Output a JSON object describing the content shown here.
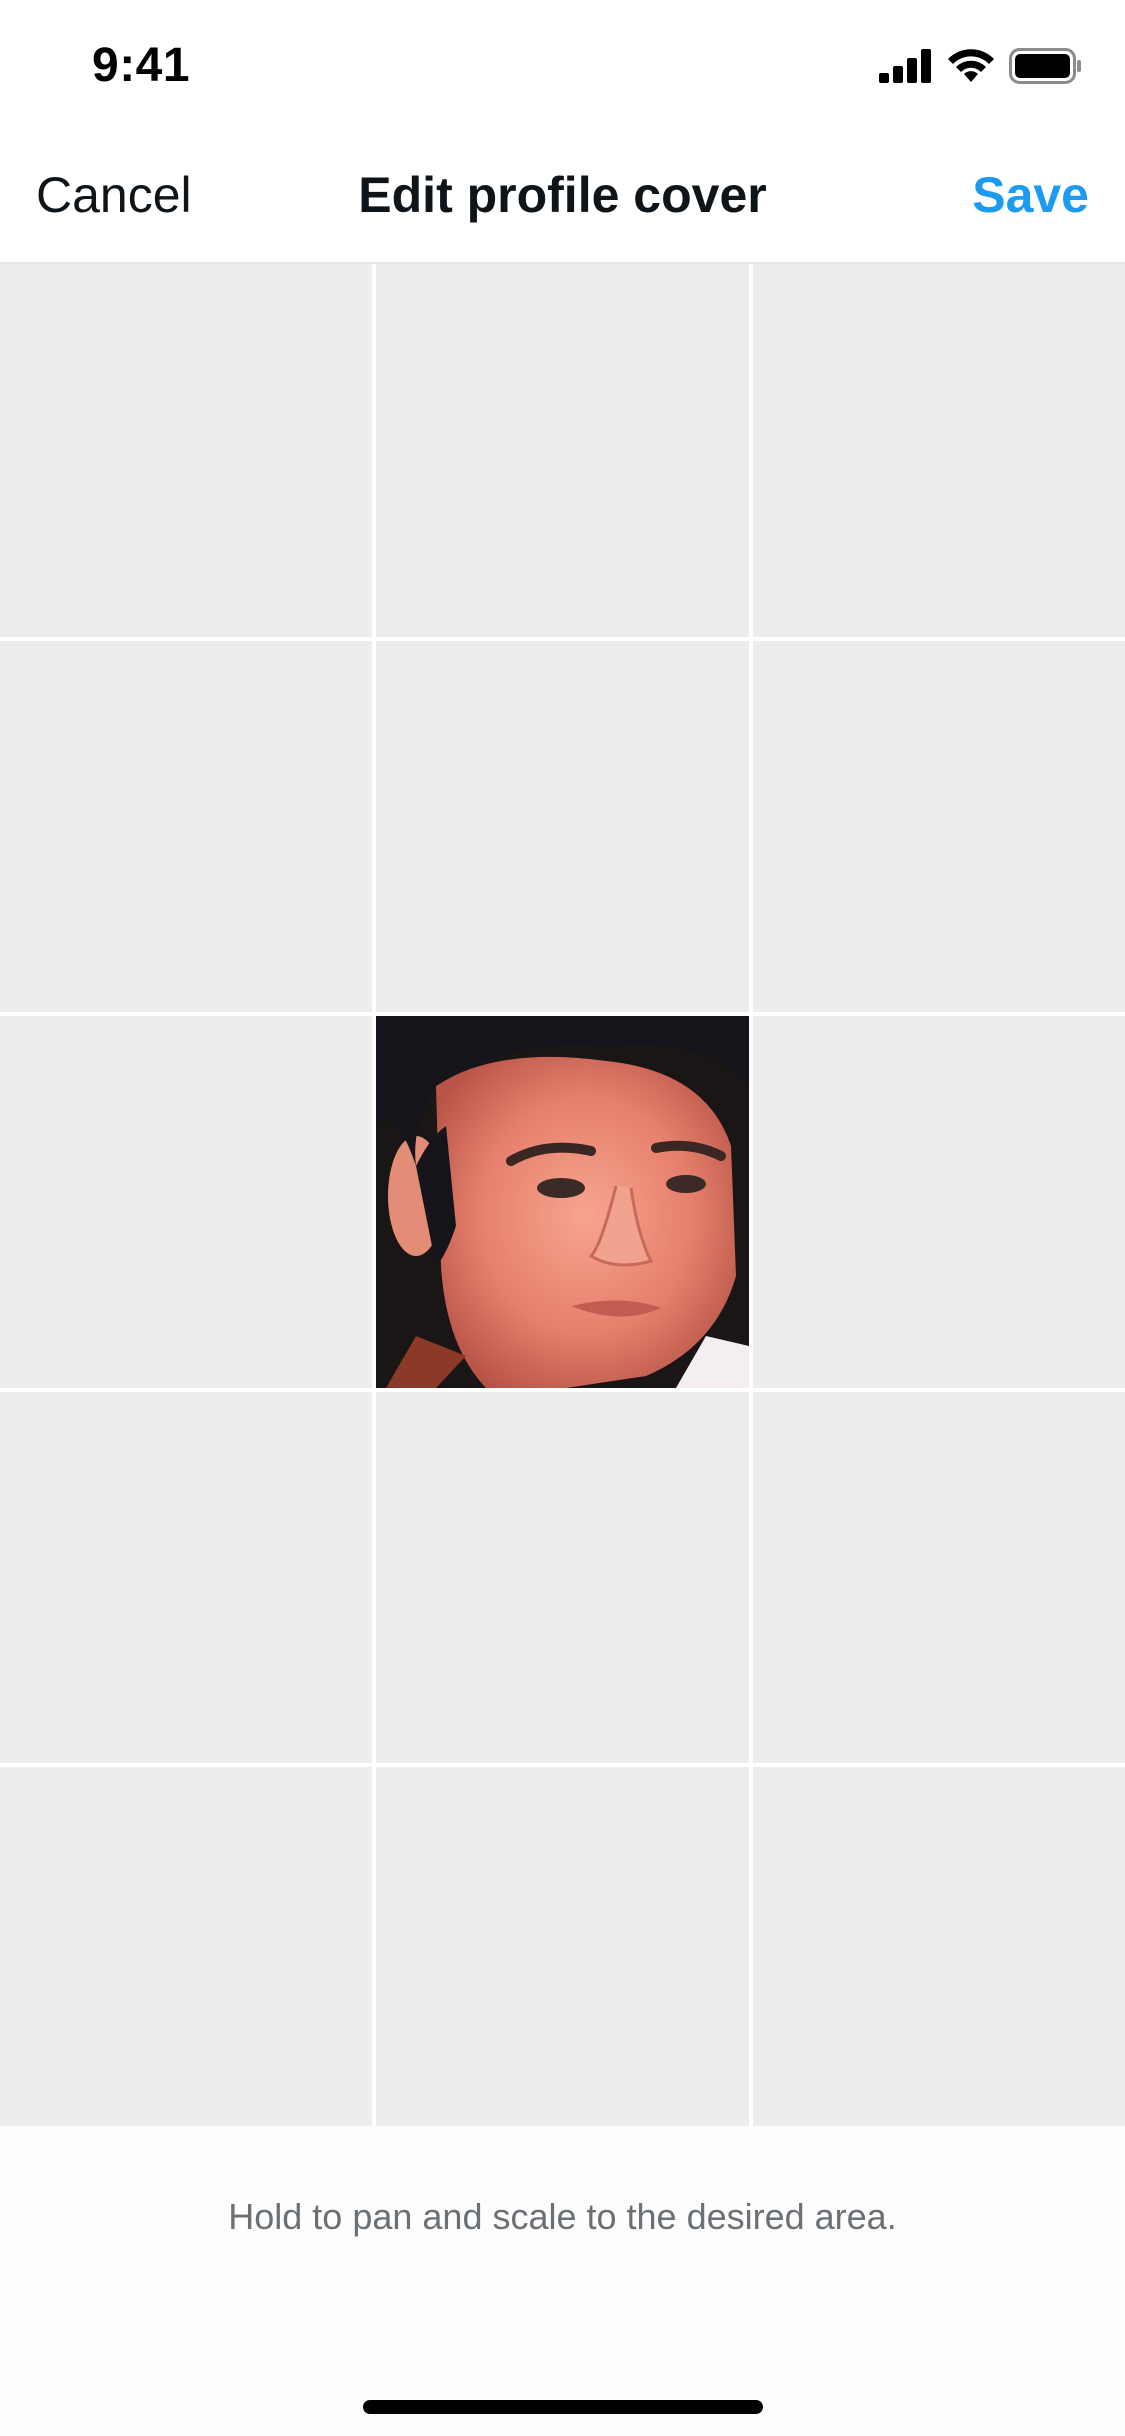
{
  "status_bar": {
    "time": "9:41"
  },
  "nav": {
    "cancel_label": "Cancel",
    "title": "Edit profile cover",
    "save_label": "Save"
  },
  "footer": {
    "hint": "Hold to pan and scale to the desired area."
  },
  "colors": {
    "accent": "#1d9bf0",
    "grid_bg": "#ededed",
    "text_primary": "#0f1419",
    "text_secondary": "#6b7075"
  },
  "icons": [
    "cellular-signal-icon",
    "wifi-icon",
    "battery-icon"
  ]
}
